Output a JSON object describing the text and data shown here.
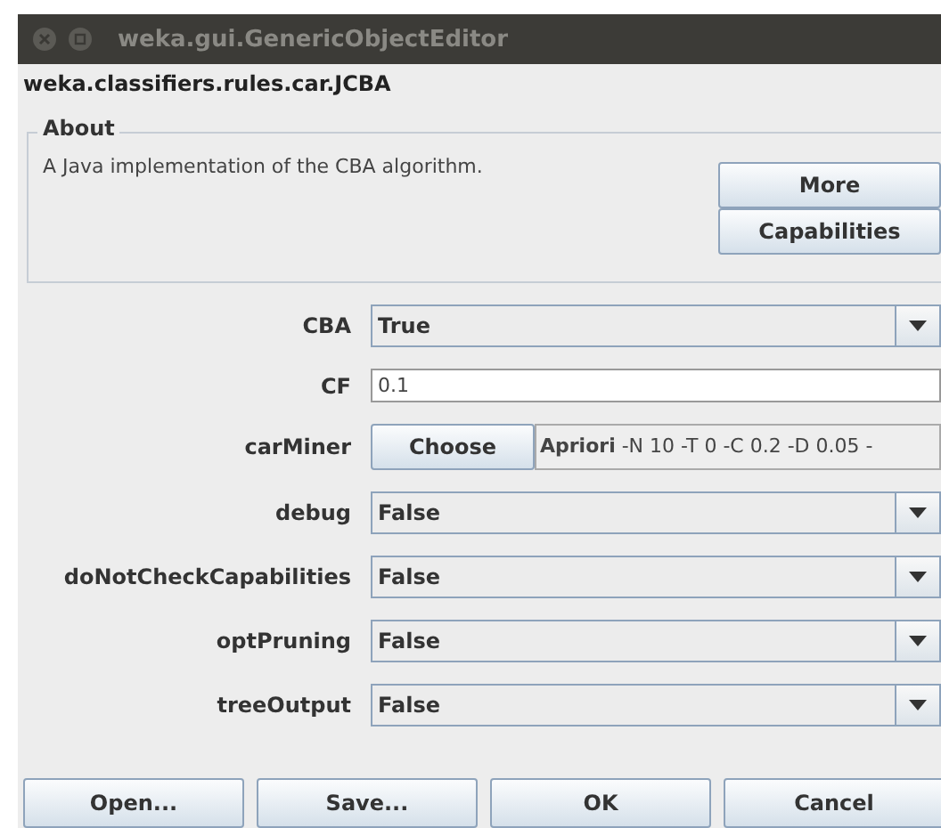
{
  "window": {
    "title": "weka.gui.GenericObjectEditor"
  },
  "class_name": "weka.classifiers.rules.car.JCBA",
  "about": {
    "title": "About",
    "text": "A Java implementation of the CBA algorithm.",
    "buttons": [
      "More",
      "Capabilities"
    ]
  },
  "properties": [
    {
      "kind": "dropdown",
      "label": "CBA",
      "value": "True"
    },
    {
      "kind": "text",
      "label": "CF",
      "value": "0.1"
    },
    {
      "kind": "object",
      "label": "carMiner",
      "button": "Choose",
      "value": "**Apriori** -N 10 -T 0 -C 0.2 -D 0.05 -"
    },
    {
      "kind": "dropdown",
      "label": "debug",
      "value": "False"
    },
    {
      "kind": "dropdown",
      "label": "doNotCheckCapabilities",
      "value": "False"
    },
    {
      "kind": "dropdown",
      "label": "optPruning",
      "value": "False"
    },
    {
      "kind": "dropdown",
      "label": "treeOutput",
      "value": "False"
    }
  ],
  "buttons": [
    "Open...",
    "Save...",
    "OK",
    "Cancel"
  ]
}
